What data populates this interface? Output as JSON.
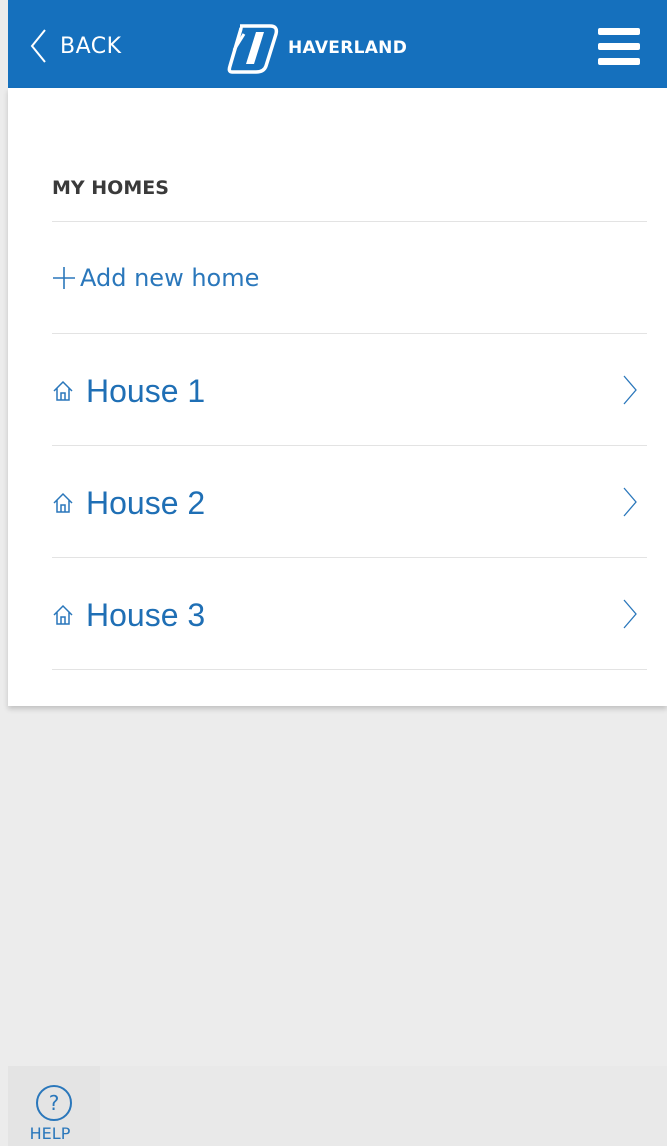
{
  "header": {
    "back_label": "BACK",
    "brand": "HAVERLAND",
    "menu_icon": "hamburger-menu-icon",
    "color": "#1570bd"
  },
  "homes": {
    "title": "MY HOMES",
    "add_label": "Add new home",
    "items": [
      {
        "label": "House 1"
      },
      {
        "label": "House 2"
      },
      {
        "label": "House 3"
      }
    ]
  },
  "footer": {
    "help_label": "HELP"
  },
  "colors": {
    "accent": "#1f6fb5",
    "background": "#ececec"
  }
}
